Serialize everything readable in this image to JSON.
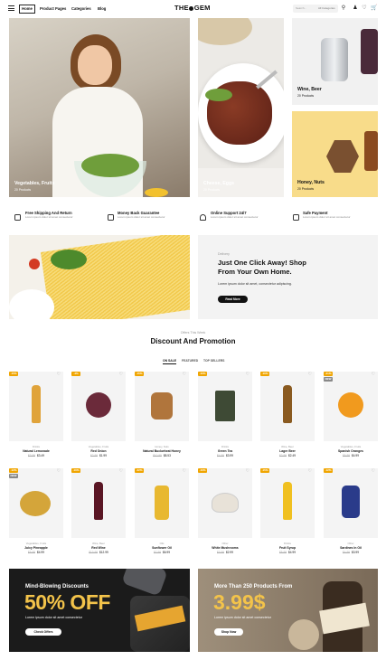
{
  "header": {
    "nav": [
      "Home",
      "Product Pages",
      "Categories",
      "Blog"
    ],
    "logo_left": "THE",
    "logo_right": "GEM",
    "search_placeholder": "Search...",
    "search_category": "All Categories"
  },
  "tiles": [
    {
      "title": "Vegetables, Fruits",
      "sub": "20 Products"
    },
    {
      "title": "Cheese, Eggs",
      "sub": "20 Products"
    },
    {
      "title": "Wine, Beer",
      "sub": "20 Products"
    },
    {
      "title": "Honey, Nuts",
      "sub": "20 Products"
    }
  ],
  "features": [
    {
      "title": "Free Shipping And Return",
      "sub": "Lorem ipsum dolor sit amet consectetur"
    },
    {
      "title": "Money Back Guarantee",
      "sub": "Lorem ipsum dolor sit amet consectetur"
    },
    {
      "title": "Online Support 24/7",
      "sub": "Lorem ipsum dolor sit amet consectetur"
    },
    {
      "title": "Safe Payment",
      "sub": "Lorem ipsum dolor sit amet consectetur"
    }
  ],
  "promo": {
    "eyebrow": "Delivery",
    "line1": "Just One Click Away! Shop",
    "line2": "From Your Own Home.",
    "text": "Lorem ipsum dolor sit amet, consectetur adipiscing.",
    "button": "Read More"
  },
  "section": {
    "eyebrow": "Offers This Week",
    "title": "Discount And Promotion",
    "tabs": [
      "ON SALE",
      "FEATURED",
      "TOP SELLERS"
    ]
  },
  "products": [
    {
      "badge": "-15%",
      "cat": "Drinks",
      "name": "Natural Lemonade",
      "old": "$3.99",
      "price": "$3.49",
      "color": "#e0a33a"
    },
    {
      "badge": "-4%",
      "cat": "Vegetables, Fruits",
      "name": "Red Onion",
      "old": "$2.99",
      "price": "$1.99",
      "color": "#6b2a3a"
    },
    {
      "badge": "-15%",
      "cat": "Honey, Nuts",
      "name": "Natural Buckwheat Honey",
      "old": "$10.99",
      "price": "$8.53",
      "color": "#b0753c"
    },
    {
      "badge": "-10%",
      "cat": "Drinks",
      "name": "Green Tea",
      "old": "$4.99",
      "price": "$3.99",
      "color": "#3e4a35"
    },
    {
      "badge": "-10%",
      "cat": "Wine, Beer",
      "name": "Lager Beer",
      "old": "$2.99",
      "price": "$2.49",
      "color": "#8a5a20"
    },
    {
      "badge": "-21%",
      "badge2": "NEW",
      "cat": "Vegetables, Fruits",
      "name": "Spanish Oranges",
      "old": "$5.99",
      "price": "$4.99",
      "color": "#f19a1e"
    },
    {
      "badge": "-12%",
      "badge2": "NEW",
      "cat": "Vegetables, Fruits",
      "name": "Juicy Pineapple",
      "old": "$5.99",
      "price": "$4.99",
      "color": "#d4a53a"
    },
    {
      "badge": "-10%",
      "cat": "Wine, Beer",
      "name": "Red Wine",
      "old": "$13.99",
      "price": "$12.99",
      "color": "#5a1624"
    },
    {
      "badge": "-22%",
      "cat": "Oils",
      "name": "Sunflower Oil",
      "old": "$7.99",
      "price": "$6.99",
      "color": "#e8b830"
    },
    {
      "badge": "-10%",
      "cat": "Other",
      "name": "White Mushrooms",
      "old": "$3.99",
      "price": "$2.99",
      "color": "#e8e2d8"
    },
    {
      "badge": "-15%",
      "cat": "Drinks",
      "name": "Fruit Syrup",
      "old": "$5.99",
      "price": "$4.99",
      "color": "#f0c020"
    },
    {
      "badge": "-12%",
      "cat": "Other",
      "name": "Sardines In Oil",
      "old": "$4.99",
      "price": "$3.99",
      "color": "#2a3b8a"
    }
  ],
  "banners": [
    {
      "title": "Mind-Blowing Discounts",
      "big": "50% OFF",
      "text": "Lorem ipsum dolor sit amet consectetur",
      "button": "Check Offers"
    },
    {
      "title": "More Than 250 Products From",
      "big": "3.99$",
      "text": "Lorem ipsum dolor sit amet consectetur",
      "button": "Shop Now"
    }
  ],
  "colors": {
    "badge": "#f0a500",
    "accent": "#f3c34a",
    "dark": "#111111"
  }
}
